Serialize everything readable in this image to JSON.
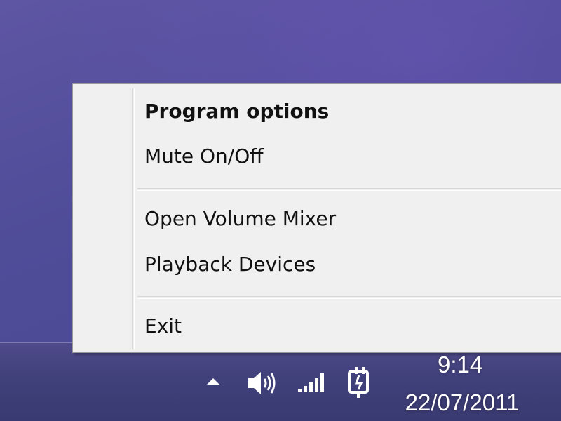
{
  "context_menu": {
    "items": [
      {
        "label": "Program options",
        "bold": true
      },
      {
        "label": "Mute On/Off"
      },
      {
        "label": "Open Volume Mixer"
      },
      {
        "label": "Playback Devices"
      },
      {
        "label": "Exit"
      }
    ]
  },
  "tray": {
    "icons": [
      "show-hidden-icons-arrow",
      "speaker-icon",
      "network-signal-icon",
      "power-plug-icon"
    ]
  },
  "clock": {
    "time": "9:14",
    "date": "22/07/2011"
  },
  "colors": {
    "desktop": "#4f4c98",
    "taskbar": "#40407a",
    "menu_bg": "#f0f0f0"
  }
}
